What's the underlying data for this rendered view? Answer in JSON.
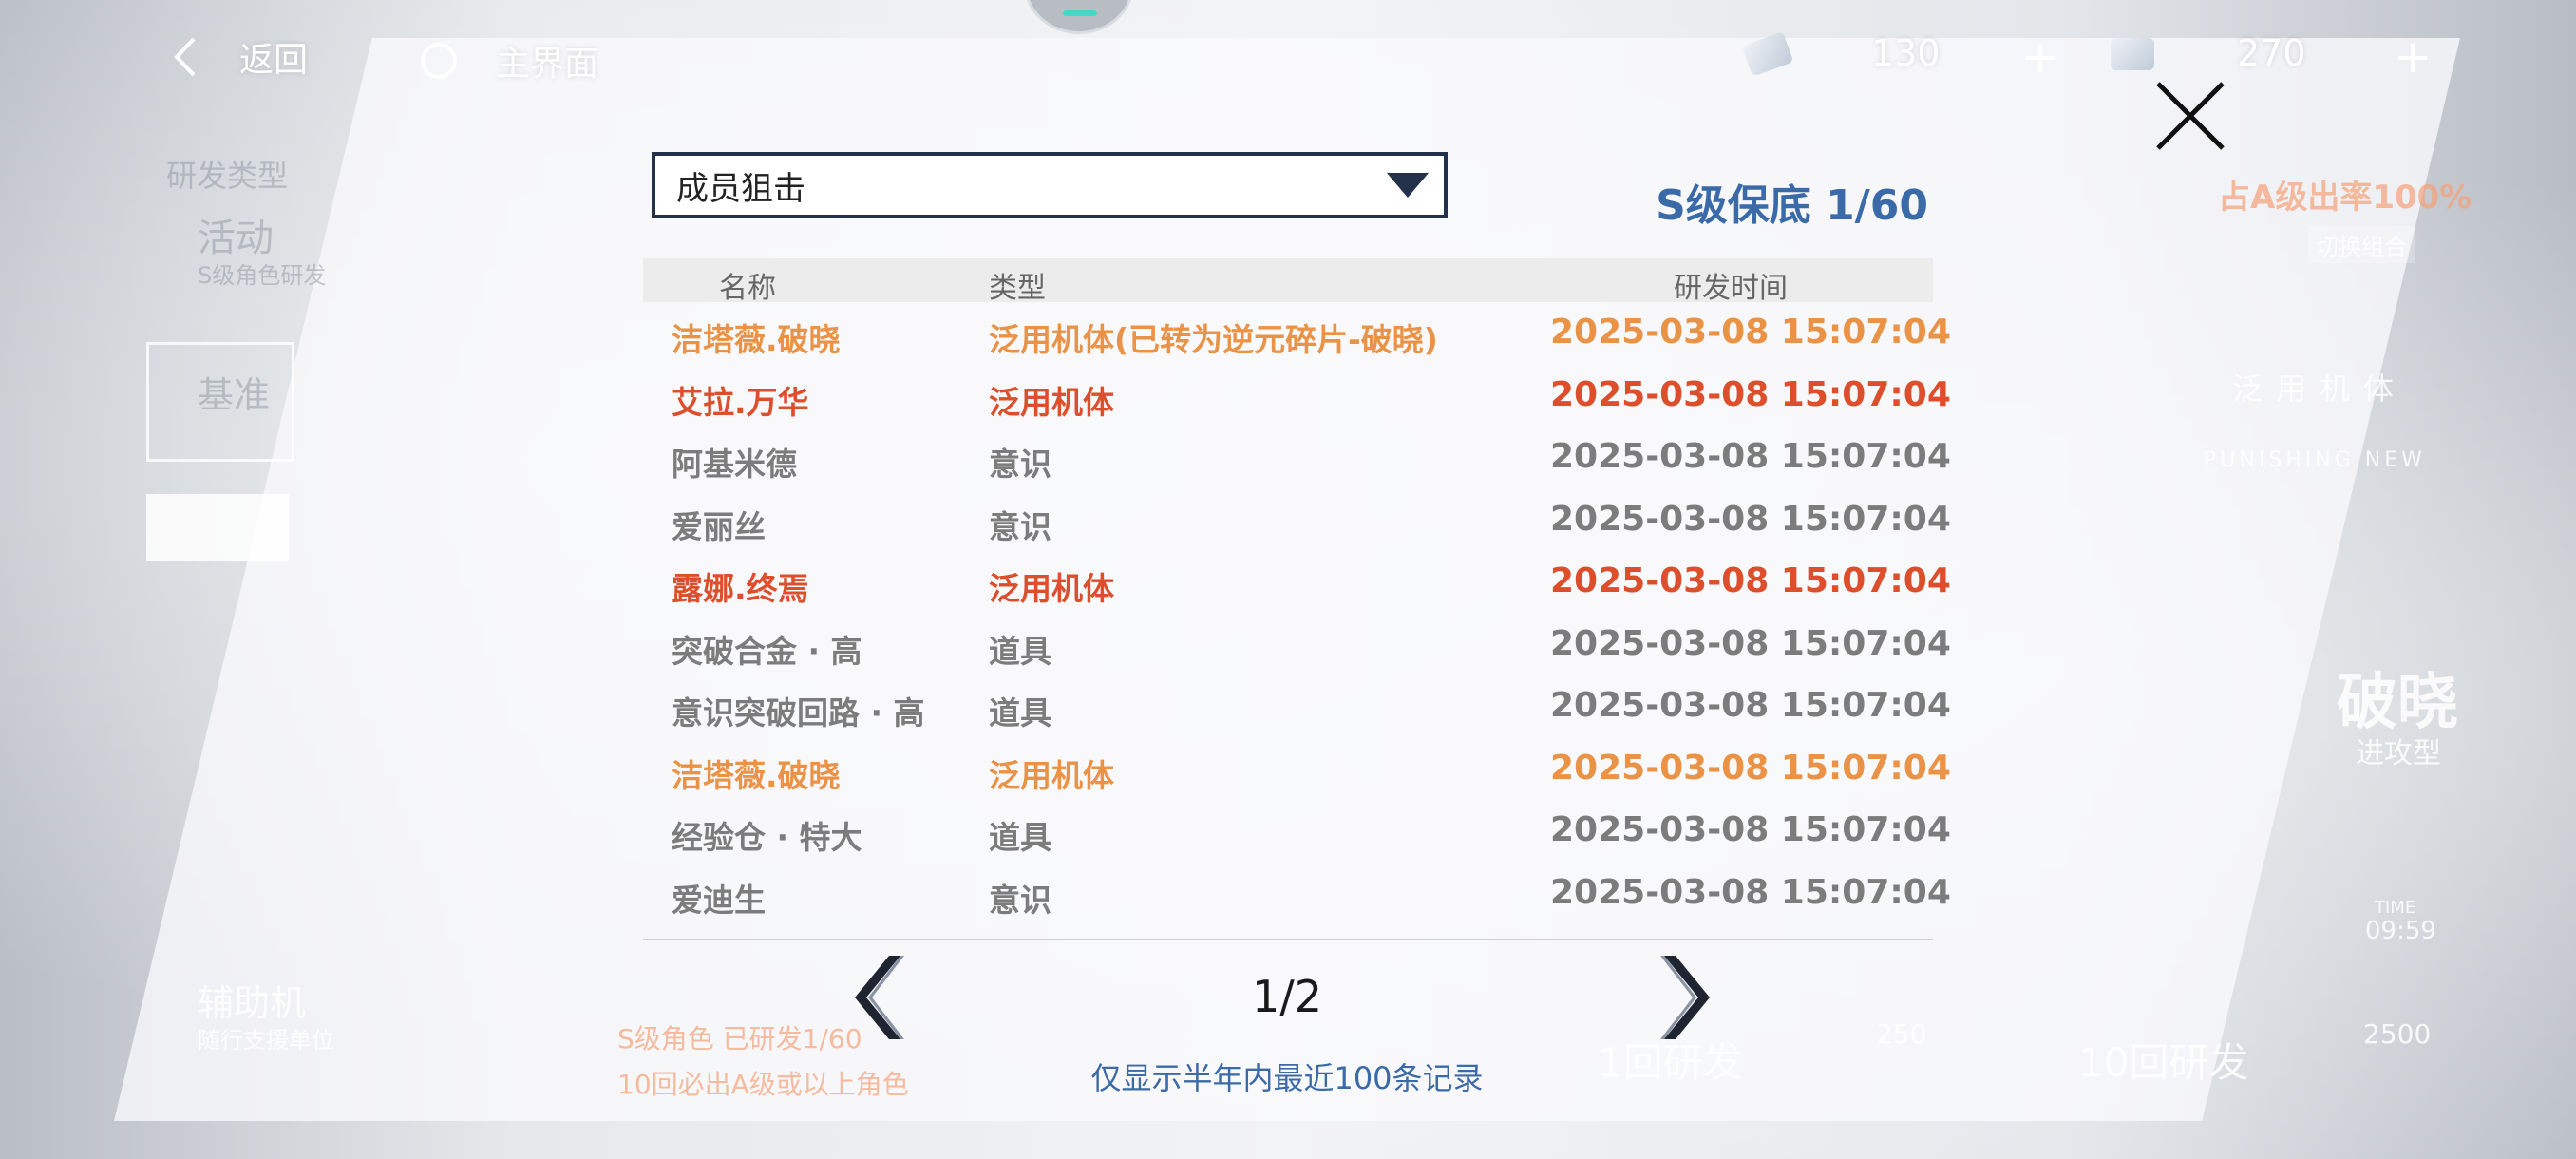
{
  "colors": {
    "orange": "#ea9246",
    "red": "#dc4e2c",
    "gray": "#7c7c7c",
    "blue_accent": "#3b6aa8"
  },
  "topbar": {
    "back_label": "返回",
    "home_label": "主界面",
    "resource1_value": "130",
    "resource2_value": "270",
    "plus": "+"
  },
  "background": {
    "section_label": "研发类型",
    "activity_label": "活动",
    "activity_sub": "S级角色研发",
    "standard_label": "基准",
    "support_label": "辅助机",
    "support_sub": "随行支援单位",
    "rate_label": "占A级出率100%",
    "switch_label": "切换组合",
    "universal_label": "泛用机体",
    "brand_label": "PUNISHING NEW",
    "char_label": "破晓",
    "char_sub": "进攻型",
    "timer_label": "TIME",
    "timer_value": "09:59",
    "guarantee_label": "S级角色 已研发1/60",
    "guarantee_sub": "10回必出A级或以上角色",
    "draw1_label": "1回研发",
    "draw1_cost": "250",
    "draw10_label": "10回研发",
    "draw10_cost": "2500"
  },
  "modal": {
    "dropdown_value": "成员狙击",
    "pity_text": "S级保底 1/60",
    "headers": {
      "name": "名称",
      "type": "类型",
      "time": "研发时间"
    },
    "rows": [
      {
        "name": "洁塔薇.破晓",
        "type": "泛用机体(已转为逆元碎片-破晓)",
        "time": "2025-03-08 15:07:04",
        "color": "#ea9246"
      },
      {
        "name": "艾拉.万华",
        "type": "泛用机体",
        "time": "2025-03-08 15:07:04",
        "color": "#dc4e2c"
      },
      {
        "name": "阿基米德",
        "type": "意识",
        "time": "2025-03-08 15:07:04",
        "color": "#7c7c7c"
      },
      {
        "name": "爱丽丝",
        "type": "意识",
        "time": "2025-03-08 15:07:04",
        "color": "#7c7c7c"
      },
      {
        "name": "露娜.终焉",
        "type": "泛用机体",
        "time": "2025-03-08 15:07:04",
        "color": "#dc4e2c"
      },
      {
        "name": "突破合金 · 高",
        "type": "道具",
        "time": "2025-03-08 15:07:04",
        "color": "#7c7c7c"
      },
      {
        "name": "意识突破回路 · 高",
        "type": "道具",
        "time": "2025-03-08 15:07:04",
        "color": "#7c7c7c"
      },
      {
        "name": "洁塔薇.破晓",
        "type": "泛用机体",
        "time": "2025-03-08 15:07:04",
        "color": "#ea9246"
      },
      {
        "name": "经验仓 · 特大",
        "type": "道具",
        "time": "2025-03-08 15:07:04",
        "color": "#7c7c7c"
      },
      {
        "name": "爱迪生",
        "type": "意识",
        "time": "2025-03-08 15:07:04",
        "color": "#7c7c7c"
      }
    ],
    "page_indicator": "1/2",
    "note": "仅显示半年内最近100条记录"
  }
}
